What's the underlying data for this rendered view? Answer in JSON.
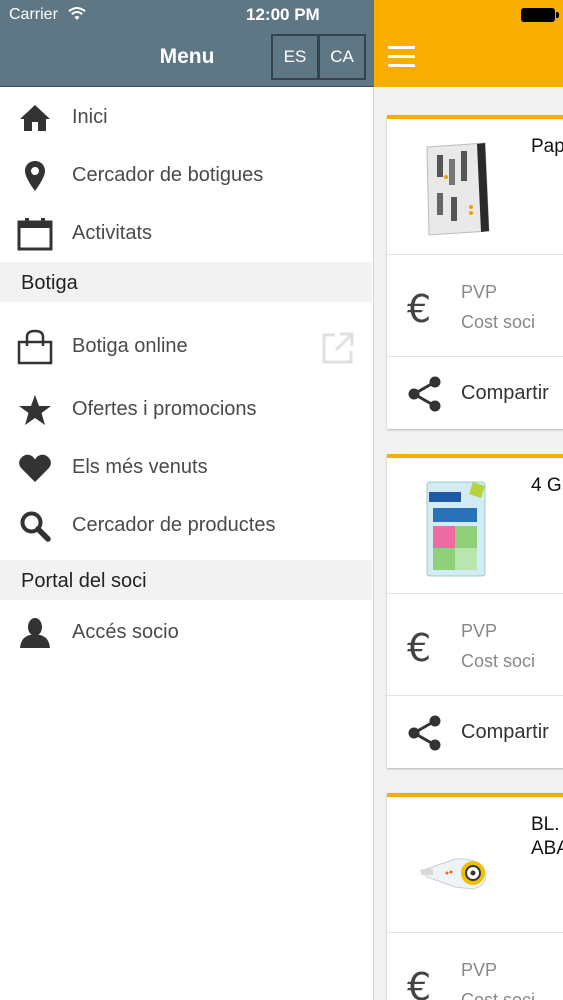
{
  "status_bar": {
    "carrier": "Carrier",
    "time": "12:00 PM"
  },
  "menu": {
    "title": "Menu",
    "languages": [
      "ES",
      "CA"
    ],
    "items_top": [
      {
        "label": "Inici",
        "icon": "home-icon"
      },
      {
        "label": "Cercador de botigues",
        "icon": "map-pin-icon"
      },
      {
        "label": "Activitats",
        "icon": "calendar-icon"
      }
    ],
    "section_botiga": "Botiga",
    "items_botiga": [
      {
        "label": "Botiga online",
        "icon": "shopping-bag-icon"
      },
      {
        "label": "Ofertes i promocions",
        "icon": "star-icon"
      },
      {
        "label": "Els més venuts",
        "icon": "heart-icon"
      },
      {
        "label": "Cercador de productes",
        "icon": "search-icon"
      }
    ],
    "section_portal": "Portal del soci",
    "items_portal": [
      {
        "label": "Accés socio",
        "icon": "user-icon"
      }
    ]
  },
  "products": [
    {
      "title": "Pap",
      "pvp_label": "PVP",
      "cost_label": "Cost soci",
      "share_label": "Compartir"
    },
    {
      "title": "4 G",
      "pvp_label": "PVP",
      "cost_label": "Cost soci",
      "share_label": "Compartir"
    },
    {
      "title": "BL. ABA",
      "title_line1": "BL.",
      "title_line2": "ABA",
      "pvp_label": "PVP",
      "cost_label": "Cost soci"
    }
  ],
  "colors": {
    "accent": "#f8ae00",
    "drawer_header": "#5f7785"
  }
}
